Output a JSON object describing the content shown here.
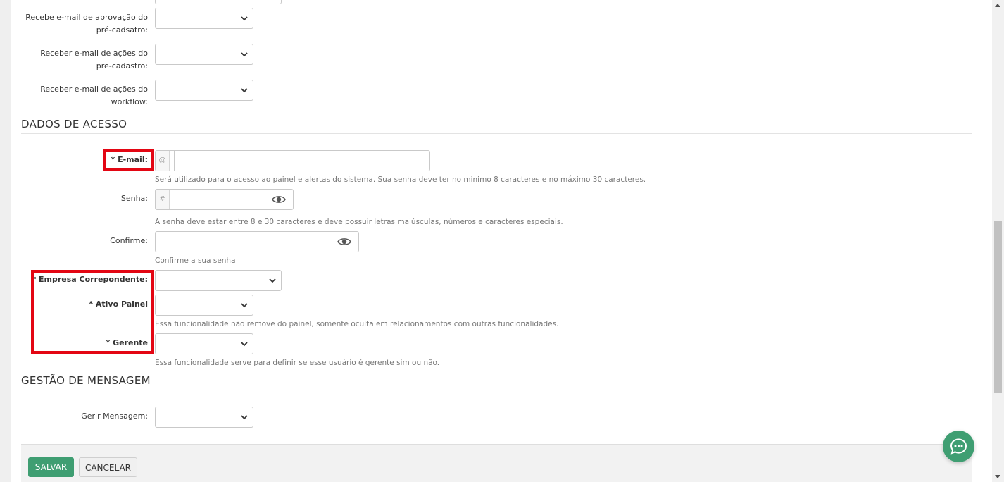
{
  "notifications": {
    "precadastro_approval_label": "Recebe e-mail de aprovação do pré-cadsatro:",
    "precadastro_actions_label": "Receber e-mail de ações do pre-cadastro:",
    "workflow_actions_label": "Receber e-mail de ações do workflow:"
  },
  "access": {
    "section_title": "DADOS DE ACESSO",
    "email_label": "* E-mail:",
    "email_addon": "@",
    "email_value": "",
    "email_help": "Será utilizado para o acesso ao painel e alertas do sistema. Sua senha deve ter no minimo 8 caracteres e no máximo 30 caracteres.",
    "password_label": "Senha:",
    "password_addon": "#",
    "password_value": "",
    "password_help": "A senha deve estar entre 8 e 30 caracteres e deve possuir letras maiúsculas, números e caracteres especiais.",
    "confirm_label": "Confirme:",
    "confirm_value": "",
    "confirm_help": "Confirme a sua senha",
    "company_label": "* Empresa Correpondente:",
    "active_label": "* Ativo Painel",
    "active_help": "Essa funcionalidade não remove do painel, somente oculta em relacionamentos com outras funcionalidades.",
    "manager_label": "* Gerente",
    "manager_help": "Essa funcionalidade serve para definir se esse usuário é gerente sim ou não."
  },
  "messages": {
    "section_title": "GESTÃO DE MENSAGEM",
    "manage_label": "Gerir Mensagem:"
  },
  "footer": {
    "save_label": "SALVAR",
    "cancel_label": "CANCELAR"
  },
  "colors": {
    "primary": "#3f9e72",
    "highlight": "#e30613"
  }
}
